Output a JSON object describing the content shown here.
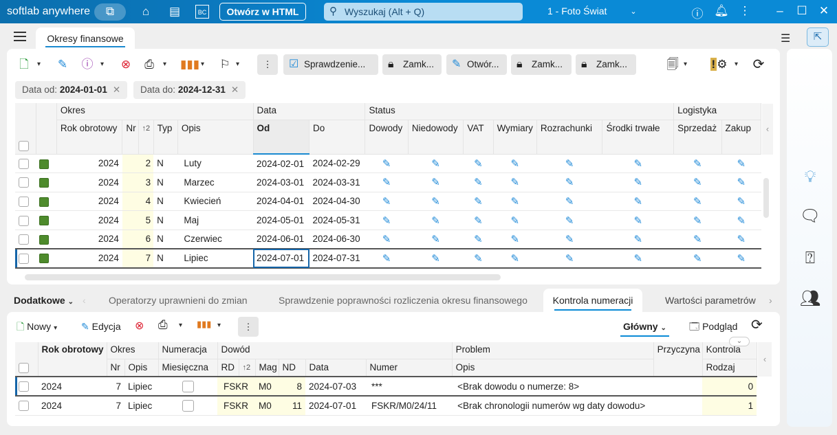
{
  "titlebar": {
    "brand": "softlab anywhere",
    "open_html": "Otwórz w HTML",
    "search_placeholder": "Wyszukaj (Alt + Q)",
    "company": "1 - Foto Świat",
    "icons": [
      "apps-icon",
      "home-icon",
      "news-icon",
      "bc-icon",
      "chevron-down-icon",
      "help-icon",
      "bell-icon",
      "more-vert-icon",
      "minimize-icon",
      "maximize-icon",
      "close-icon"
    ]
  },
  "doc_tab": {
    "label": "Okresy finansowe"
  },
  "toolbar": {
    "buttons": [
      "Sprawdzenie...",
      "Zamk...",
      "Otwór...",
      "Zamk...",
      "Zamk..."
    ]
  },
  "filters": [
    {
      "label": "Data od:",
      "value": "2024-01-01"
    },
    {
      "label": "Data do:",
      "value": "2024-12-31"
    }
  ],
  "top_grid": {
    "groups": [
      "Okres",
      "Data",
      "Status",
      "Logistyka"
    ],
    "columns": [
      "Rok obrotowy",
      "Nr",
      "Typ",
      "Opis",
      "Od",
      "Do",
      "Dowody",
      "Niedowody",
      "VAT",
      "Wymiary",
      "Rozrachunki",
      "Środki trwałe",
      "Sprzedaż",
      "Zakup"
    ],
    "sort_indicator": "↑2",
    "status_color": "#4e8b2c",
    "rows": [
      {
        "rok": "2024",
        "nr": "2",
        "typ": "N",
        "opis": "Luty",
        "od": "2024-02-01",
        "do": "2024-02-29"
      },
      {
        "rok": "2024",
        "nr": "3",
        "typ": "N",
        "opis": "Marzec",
        "od": "2024-03-01",
        "do": "2024-03-31"
      },
      {
        "rok": "2024",
        "nr": "4",
        "typ": "N",
        "opis": "Kwiecień",
        "od": "2024-04-01",
        "do": "2024-04-30"
      },
      {
        "rok": "2024",
        "nr": "5",
        "typ": "N",
        "opis": "Maj",
        "od": "2024-05-01",
        "do": "2024-05-31"
      },
      {
        "rok": "2024",
        "nr": "6",
        "typ": "N",
        "opis": "Czerwiec",
        "od": "2024-06-01",
        "do": "2024-06-30"
      },
      {
        "rok": "2024",
        "nr": "7",
        "typ": "N",
        "opis": "Lipiec",
        "od": "2024-07-01",
        "do": "2024-07-31"
      }
    ]
  },
  "bottom_tabs": {
    "dropdown": "Dodatkowe",
    "tabs": [
      "Operatorzy uprawnieni do zmian",
      "Sprawdzenie poprawności rozliczenia okresu finansowego",
      "Kontrola numeracji",
      "Wartości parametrów"
    ],
    "active": "Kontrola numeracji"
  },
  "bottom_toolbar": {
    "new": "Nowy",
    "edit": "Edycja",
    "view": "Główny",
    "preview": "Podgląd"
  },
  "bottom_grid": {
    "groups": [
      "Rok obrotowy",
      "Okres",
      "Numeracja",
      "Dowód",
      "Problem",
      "Przyczyna",
      "Kontrola"
    ],
    "columns": [
      "Nr",
      "Opis",
      "Miesięczna",
      "RD",
      "Mag",
      "ND",
      "Data",
      "Numer",
      "Opis",
      "Rodzaj"
    ],
    "sort_indicator": "↑2",
    "rows": [
      {
        "rok": "2024",
        "nr": "7",
        "opis": "Lipiec",
        "rd": "FSKR",
        "mag": "M0",
        "nd": "8",
        "data": "2024-07-03",
        "numer": "***",
        "problem": "<Brak dowodu o numerze: 8>",
        "rodzaj": "0"
      },
      {
        "rok": "2024",
        "nr": "7",
        "opis": "Lipiec",
        "rd": "FSKR",
        "mag": "M0",
        "nd": "11",
        "data": "2024-07-01",
        "numer": "FSKR/M0/24/11",
        "problem": "<Brak chronologii numerów wg daty dowodu>",
        "rodzaj": "1"
      }
    ]
  },
  "accent": "#0a8ad6"
}
